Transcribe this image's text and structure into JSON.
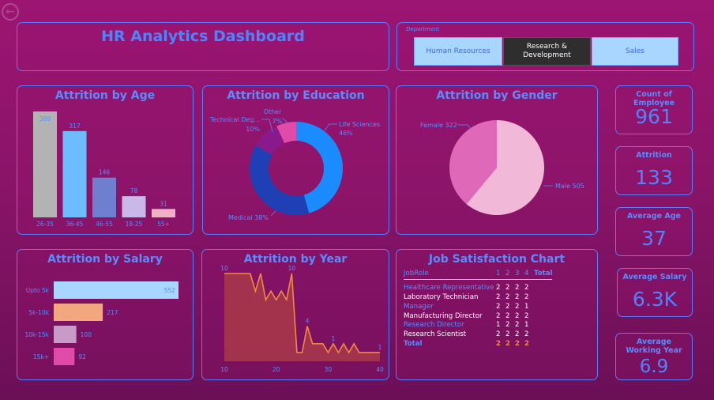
{
  "dashboard_title": "HR Analytics Dashboard",
  "back_icon": "back-arrow-icon",
  "department_slicer": {
    "label": "Department",
    "options": [
      {
        "label": "Human Resources",
        "selected": false
      },
      {
        "label": "Research & Development",
        "selected": true
      },
      {
        "label": "Sales",
        "selected": false
      }
    ]
  },
  "kpis": [
    {
      "label": "Count of Employee",
      "value": "961"
    },
    {
      "label": "Attrition",
      "value": "133"
    },
    {
      "label": "Average Age",
      "value": "37"
    },
    {
      "label": "Average Salary",
      "value": "6.3K"
    },
    {
      "label": "Average Working Year",
      "value": "6.9"
    }
  ],
  "panels": {
    "age": "Attrition by Age",
    "education": "Attrition by Education",
    "gender": "Attrition by Gender",
    "salary": "Attrition by Salary",
    "year": "Attrition by Year",
    "job": "Job Satisfaction Chart"
  },
  "colors": {
    "accent": "#4f84ff",
    "background": "#8a1468"
  },
  "chart_data": [
    {
      "id": "age",
      "type": "bar",
      "title": "Attrition by Age",
      "categories": [
        "26-35",
        "36-45",
        "46-55",
        "18-25",
        "55+"
      ],
      "values": [
        389,
        317,
        146,
        78,
        31
      ],
      "colors": [
        "#b3b3b3",
        "#6cbcff",
        "#6f7fd0",
        "#c9b8e8",
        "#f2b0c6"
      ],
      "ylim": [
        0,
        389
      ]
    },
    {
      "id": "education",
      "type": "pie",
      "title": "Attrition by Education",
      "categories": [
        "Life Sciences",
        "Medical",
        "Technical Degree",
        "Other"
      ],
      "labels": [
        "Life Sciences",
        "Medical",
        "Technical Deg...",
        "Other"
      ],
      "values": [
        46,
        38,
        10,
        7
      ],
      "value_labels": [
        "46%",
        "38%",
        "10%",
        "7%"
      ],
      "colors": [
        "#1a8cff",
        "#1f3fb5",
        "#8a1a8c",
        "#e04aa8"
      ]
    },
    {
      "id": "gender",
      "type": "pie",
      "title": "Attrition by Gender",
      "categories": [
        "Male",
        "Female"
      ],
      "values": [
        505,
        322
      ],
      "colors": [
        "#f2b8d8",
        "#e068b8"
      ]
    },
    {
      "id": "salary",
      "type": "bar",
      "orientation": "horizontal",
      "title": "Attrition by Salary",
      "categories": [
        "Upto 5k",
        "5k-10k",
        "10k-15k",
        "15k+"
      ],
      "values": [
        552,
        217,
        100,
        92
      ],
      "colors": [
        "#a9d6ff",
        "#f2a77e",
        "#c79ac7",
        "#e04aa8"
      ],
      "xlim": [
        0,
        552
      ]
    },
    {
      "id": "year",
      "type": "area",
      "title": "Attrition by Year",
      "x": [
        10,
        11,
        12,
        13,
        14,
        15,
        16,
        17,
        18,
        19,
        20,
        21,
        22,
        23,
        24,
        25,
        26,
        27,
        28,
        29,
        30,
        31,
        32,
        33,
        34,
        35,
        36,
        37,
        38,
        39,
        40
      ],
      "y": [
        10,
        10,
        10,
        10,
        10,
        10,
        8,
        10,
        7,
        8,
        7,
        8,
        7,
        10,
        1,
        1,
        4,
        2,
        2,
        2,
        1,
        2,
        1,
        2,
        1,
        2,
        1,
        1,
        1,
        1,
        1
      ],
      "xticks": [
        10,
        20,
        30,
        40
      ],
      "data_labels": [
        {
          "x": 10,
          "y": 10,
          "text": "10"
        },
        {
          "x": 23,
          "y": 10,
          "text": "10"
        },
        {
          "x": 26,
          "y": 4,
          "text": "4"
        },
        {
          "x": 31,
          "y": 2,
          "text": "1"
        },
        {
          "x": 40,
          "y": 1,
          "text": "1"
        }
      ],
      "ylim": [
        0,
        10
      ],
      "line_color": "#f08a40",
      "fill_color": "#a9384a"
    },
    {
      "id": "job",
      "type": "table",
      "title": "Job Satisfaction Chart",
      "columns": [
        "JobRole",
        "1",
        "2",
        "3",
        "4",
        "Total"
      ],
      "rows": [
        {
          "role": "Healthcare Representative",
          "values": [
            "2",
            "2",
            "2",
            "2"
          ]
        },
        {
          "role": "Laboratory Technician",
          "values": [
            "2",
            "2",
            "2",
            "2"
          ]
        },
        {
          "role": "Manager",
          "values": [
            "2",
            "2",
            "2",
            "1"
          ]
        },
        {
          "role": "Manufacturing Director",
          "values": [
            "2",
            "2",
            "2",
            "2"
          ]
        },
        {
          "role": "Research Director",
          "values": [
            "1",
            "2",
            "2",
            "1"
          ]
        },
        {
          "role": "Research Scientist",
          "values": [
            "2",
            "2",
            "2",
            "2"
          ]
        }
      ],
      "total": {
        "role": "Total",
        "values": [
          "2",
          "2",
          "2",
          "2"
        ]
      }
    }
  ]
}
